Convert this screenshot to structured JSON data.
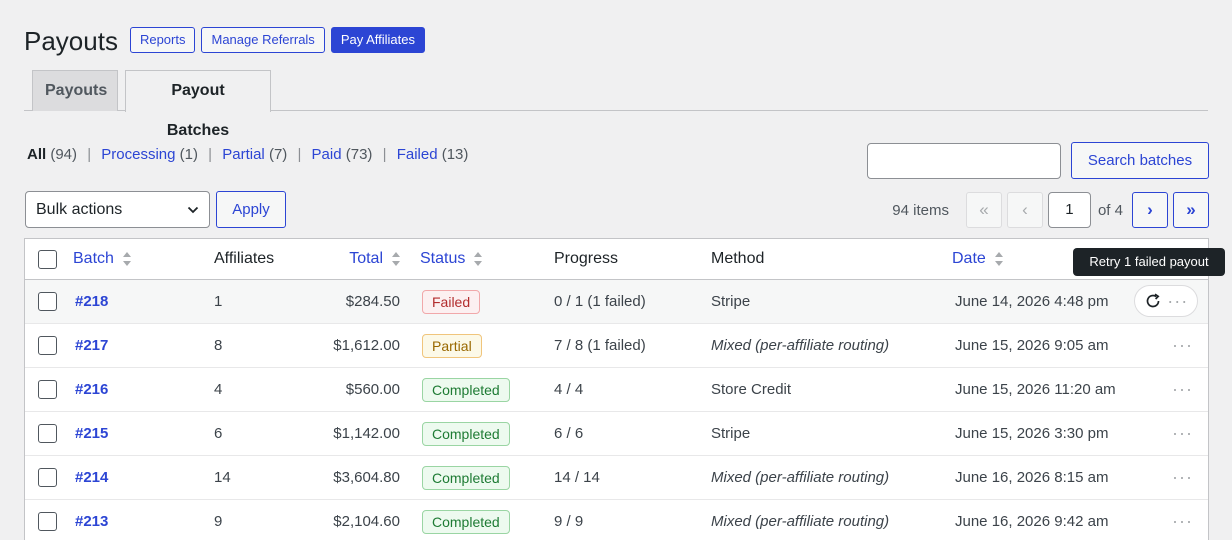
{
  "header": {
    "title": "Payouts",
    "buttons": {
      "reports": "Reports",
      "manage_referrals": "Manage Referrals",
      "pay_affiliates": "Pay Affiliates"
    }
  },
  "tabs": {
    "payouts": "Payouts",
    "payout_batches": "Payout Batches",
    "active": "Payout Batches"
  },
  "filters": {
    "all": {
      "label": "All",
      "count": "(94)"
    },
    "processing": {
      "label": "Processing",
      "count": "(1)"
    },
    "partial": {
      "label": "Partial",
      "count": "(7)"
    },
    "paid": {
      "label": "Paid",
      "count": "(73)"
    },
    "failed": {
      "label": "Failed",
      "count": "(13)"
    }
  },
  "search": {
    "value": "",
    "button": "Search batches"
  },
  "bulk": {
    "selected": "Bulk actions",
    "apply": "Apply"
  },
  "pagination": {
    "items": "94 items",
    "current_page": "1",
    "of": "of 4",
    "first": "«",
    "prev": "‹",
    "next": "›",
    "last": "»"
  },
  "columns": {
    "batch": "Batch",
    "affiliates": "Affiliates",
    "total": "Total",
    "status": "Status",
    "progress": "Progress",
    "method": "Method",
    "date": "Date"
  },
  "tooltip": "Retry 1 failed payout",
  "rows": [
    {
      "batch": "#218",
      "affiliates": "1",
      "total": "$284.50",
      "status": "Failed",
      "progress": "0 / 1 (1 failed)",
      "method": "Stripe",
      "date": "June 14, 2026 4:48 pm"
    },
    {
      "batch": "#217",
      "affiliates": "8",
      "total": "$1,612.00",
      "status": "Partial",
      "progress": "7 / 8 (1 failed)",
      "method": "Mixed (per-affiliate routing)",
      "date": "June 15, 2026 9:05 am"
    },
    {
      "batch": "#216",
      "affiliates": "4",
      "total": "$560.00",
      "status": "Completed",
      "progress": "4 / 4",
      "method": "Store Credit",
      "date": "June 15, 2026 11:20 am"
    },
    {
      "batch": "#215",
      "affiliates": "6",
      "total": "$1,142.00",
      "status": "Completed",
      "progress": "6 / 6",
      "method": "Stripe",
      "date": "June 15, 2026 3:30 pm"
    },
    {
      "batch": "#214",
      "affiliates": "14",
      "total": "$3,604.80",
      "status": "Completed",
      "progress": "14 / 14",
      "method": "Mixed (per-affiliate routing)",
      "date": "June 16, 2026 8:15 am"
    },
    {
      "batch": "#213",
      "affiliates": "9",
      "total": "$2,104.60",
      "status": "Completed",
      "progress": "9 / 9",
      "method": "Mixed (per-affiliate routing)",
      "date": "June 16, 2026 9:42 am"
    }
  ],
  "colors": {
    "accent": "#2c45d4",
    "failed": "#b32d2e",
    "partial": "#996800",
    "completed": "#1e7b34"
  }
}
